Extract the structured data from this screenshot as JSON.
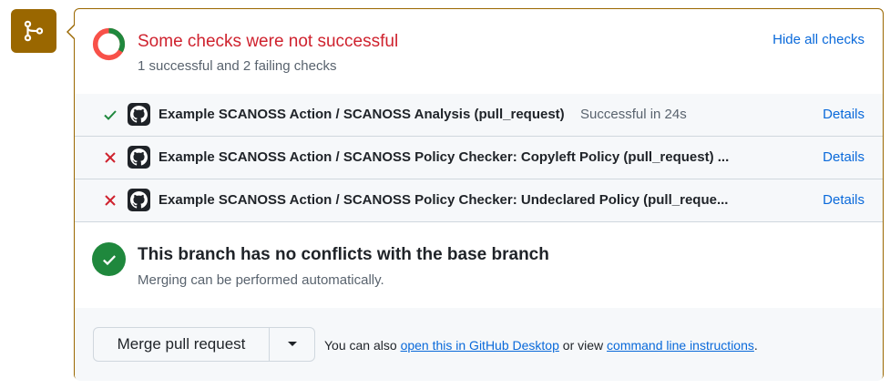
{
  "checks": {
    "title": "Some checks were not successful",
    "subtitle": "1 successful and 2 failing checks",
    "hide_all_label": "Hide all checks",
    "colors": {
      "success": "#1f883d",
      "failure": "#cf222e",
      "link": "#0969da",
      "merge_badge": "#9a6700"
    },
    "items": [
      {
        "status": "success",
        "status_icon": "check-icon",
        "name": "Example SCANOSS Action / SCANOSS Analysis (pull_request)",
        "status_text": "Successful in 24s",
        "details_label": "Details"
      },
      {
        "status": "failure",
        "status_icon": "x-icon",
        "name": "Example SCANOSS Action / SCANOSS Policy Checker: Copyleft Policy (pull_request) ...",
        "status_text": "",
        "details_label": "Details"
      },
      {
        "status": "failure",
        "status_icon": "x-icon",
        "name": "Example SCANOSS Action / SCANOSS Policy Checker: Undeclared Policy (pull_reque...",
        "status_text": "",
        "details_label": "Details"
      }
    ]
  },
  "conflicts": {
    "title": "This branch has no conflicts with the base branch",
    "subtitle": "Merging can be performed automatically."
  },
  "merge": {
    "button_label": "Merge pull request",
    "text_prefix": "You can also",
    "desktop_link": "open this in GitHub Desktop",
    "text_middle": "or view",
    "cli_link": "command line instructions",
    "text_suffix": "."
  }
}
